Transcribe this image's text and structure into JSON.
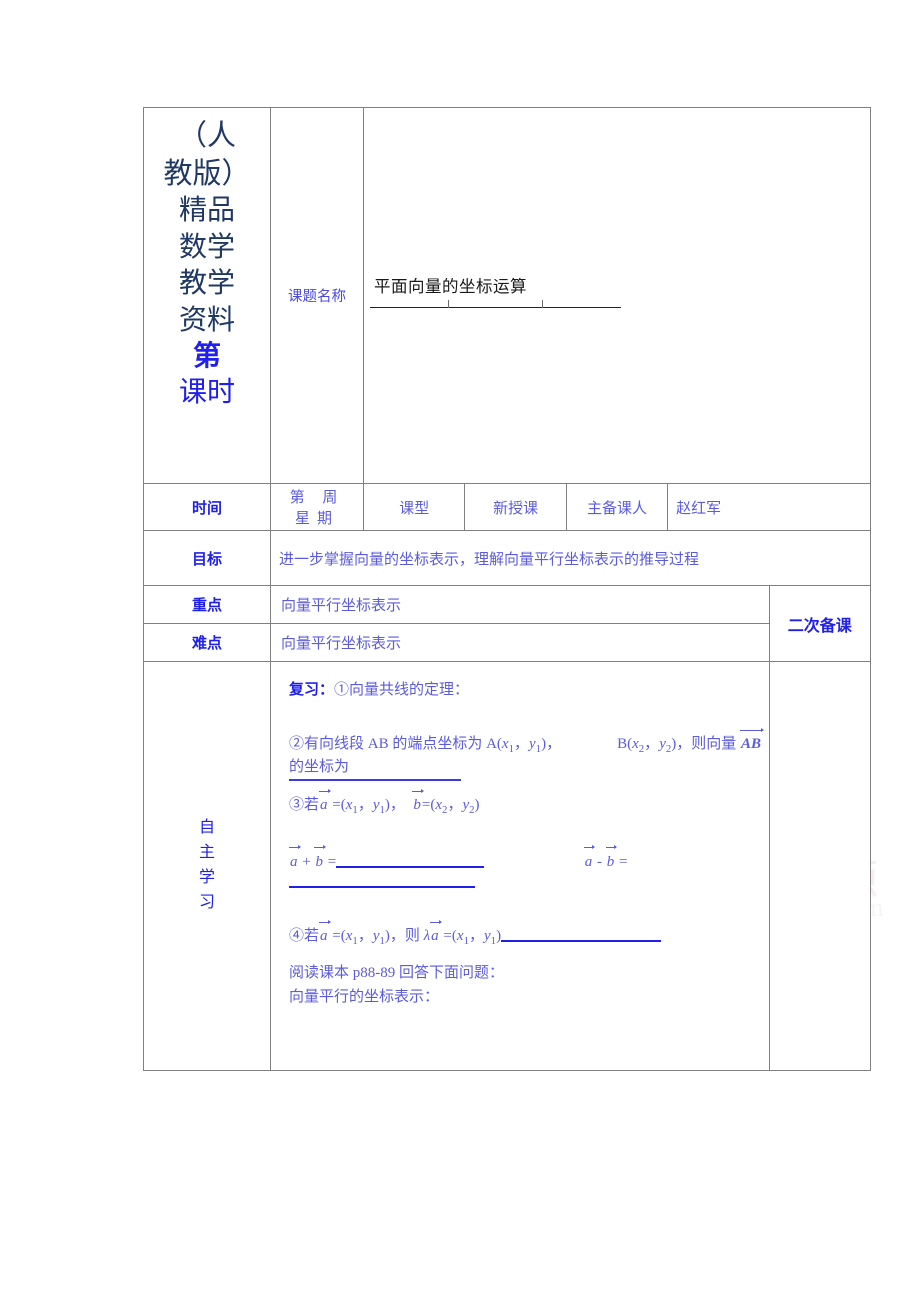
{
  "document": {
    "watermark": "高考资源网",
    "watermark_sub": "www.ks5u.com"
  },
  "banner": {
    "lines": [
      "（人",
      "教版）",
      "精品",
      "数学",
      "教学",
      "资料",
      "第",
      "课时"
    ]
  },
  "topic": {
    "label": "课题名称",
    "title": "平面向量的坐标运算"
  },
  "info_row": {
    "time_label": "时间",
    "time_value": "第 周 星期",
    "type_label": "课型",
    "type_value": "新授课",
    "preparer_label": "主备课人",
    "preparer_value": "赵红军"
  },
  "goal": {
    "label": "目标",
    "text": "进一步掌握向量的坐标表示，理解向量平行坐标表示的推导过程"
  },
  "key_point": {
    "label": "重点",
    "text": "向量平行坐标表示"
  },
  "difficulty": {
    "label": "难点",
    "text": "向量平行坐标表示"
  },
  "second_prep": {
    "label": "二次备课"
  },
  "study": {
    "label_lines": [
      "自",
      "主",
      "学",
      "习"
    ],
    "review_heading": "复习：",
    "item1": "①向量共线的定理：",
    "item2_pre": "②有向线段 AB 的端点坐标为 A(",
    "item2_a_x": "x",
    "item2_a_x_sub": "1",
    "item2_a_y": "y",
    "item2_a_y_sub": "1",
    "item2_mid": "B(",
    "item2_b_x": "x",
    "item2_b_x_sub": "2",
    "item2_b_y": "y",
    "item2_b_y_sub": "2",
    "item2_post": "，则向量",
    "item2_vec": "AB",
    "item2_tail": "的坐标为",
    "item3_pre": "③若",
    "item3_a": "a",
    "item3_b": "b",
    "item3_x1": "x",
    "item3_y1": "y",
    "item3_x2": "x",
    "item3_y2": "y",
    "sum_label_a": "a",
    "sum_label_b": "b",
    "sum_plus": "+",
    "sum_eq": "=",
    "diff_minus": "-",
    "item4_pre": "④若",
    "item4_a": "a",
    "item4_mid": "，则",
    "item4_lambda": "λ",
    "reading": "阅读课本 p88-89 回答下面问题：",
    "parallel": "向量平行的坐标表示："
  },
  "colors": {
    "navy": "#1f3864",
    "bright_blue": "#2020ee",
    "soft_blue": "#4a4ae0",
    "border_gray": "#808080",
    "title_black": "#1a1a1a"
  }
}
